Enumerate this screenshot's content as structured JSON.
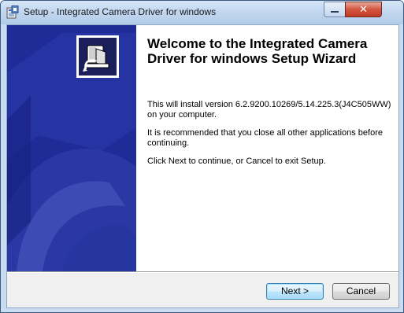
{
  "window": {
    "title": "Setup - Integrated Camera Driver for windows",
    "close_glyph": "✕"
  },
  "icons": {
    "app": "installer-app-icon",
    "product": "camera-driver-logo-icon",
    "minimize": "minimize-icon",
    "close": "close-icon"
  },
  "wizard": {
    "heading": "Welcome to the Integrated Camera Driver for windows Setup Wizard",
    "install_info": "This will install version 6.2.9200.10269/5.14.225.3(J4C505WW) on your computer.",
    "recommendation": "It is recommended that you close all other applications before continuing.",
    "instructions": "Click Next to continue, or Cancel to exit Setup."
  },
  "buttons": {
    "next": "Next >",
    "cancel": "Cancel"
  },
  "colors": {
    "side_panel": "#1f2b96",
    "titlebar": "#c2d7f0",
    "close_button": "#c23a24",
    "default_button_border": "#3c7fb1"
  }
}
